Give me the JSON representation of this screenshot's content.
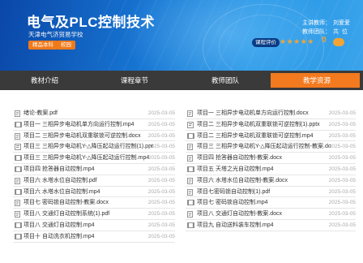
{
  "course": {
    "title": "电气及PLC控制技术",
    "school": "天津电气济贸易学校",
    "tags": [
      "精品本科",
      "校园"
    ]
  },
  "info": {
    "teacher_label": "主讲教师：",
    "teacher_name": "刘爱爱",
    "team_label": "教师团队：",
    "team_value_1": "共",
    "team_value_2": "位"
  },
  "rating": {
    "button_label": "课程评价",
    "stars": "★★★★★",
    "score": "0"
  },
  "tabs": [
    {
      "label": "教材介绍"
    },
    {
      "label": "课程章节"
    },
    {
      "label": "教师团队"
    },
    {
      "label": "教学资源"
    }
  ],
  "files_left": [
    {
      "name": "绪论-教案.pdf",
      "date": "2025-03-05",
      "type": "doc"
    },
    {
      "name": "项目一 三相异步电动机单方向运行控制.mp4",
      "date": "2025-03-05",
      "type": "video"
    },
    {
      "name": "项目二 三相异步电动机双重联锁可逆控制.docx",
      "date": "2025-03-05",
      "type": "doc"
    },
    {
      "name": "项目三 三相异步电动机Y-△降压起动运行控制(1).pptx",
      "date": "2025-03-05",
      "type": "ppt"
    },
    {
      "name": "项目三 三相异步电动机Y-△降压起动运行控制.mp4",
      "date": "2025-03-05",
      "type": "video"
    },
    {
      "name": "项目四 抢答器自动控制.mp4",
      "date": "2025-03-05",
      "type": "video"
    },
    {
      "name": "项目六 水塔水位自动控制.pdf",
      "date": "2025-03-05",
      "type": "doc"
    },
    {
      "name": "项目六 水塔水位自动控制.mp4",
      "date": "2025-03-05",
      "type": "video"
    },
    {
      "name": "项目七 密码锁自动控制-教案.docx",
      "date": "2025-03-05",
      "type": "doc"
    },
    {
      "name": "项目八 交通灯自动控制系统(1).pdf",
      "date": "2025-03-05",
      "type": "doc"
    },
    {
      "name": "项目八 交通灯自动控制.mp4",
      "date": "2025-03-05",
      "type": "video"
    },
    {
      "name": "项目十 自动洗衣机控制.mp4",
      "date": "2025-03-05",
      "type": "video"
    }
  ],
  "files_right": [
    {
      "name": "项目一 三相异步电动机单方向运行控制.docx",
      "date": "2025-03-05",
      "type": "doc"
    },
    {
      "name": "项目二 三相异步电动机双重联锁可逆控制(1).pptx",
      "date": "2025-03-05",
      "type": "ppt"
    },
    {
      "name": "项目二 三相异步电动机双重联锁可逆控制.mp4",
      "date": "2025-03-05",
      "type": "video"
    },
    {
      "name": "项目三 三相异步电动机Y-△降压起动运行控制-教案.do...",
      "date": "2025-03-05",
      "type": "doc"
    },
    {
      "name": "项目四 抢答器自动控制-教案.docx",
      "date": "2025-03-05",
      "type": "doc"
    },
    {
      "name": "项目五 天塔之光自动控制.mp4",
      "date": "2025-03-05",
      "type": "video"
    },
    {
      "name": "项目六 水塔水位自动控制-教案.docx",
      "date": "2025-03-05",
      "type": "doc"
    },
    {
      "name": "项目七密码锁自动控制(1).pdf",
      "date": "2025-03-05",
      "type": "doc"
    },
    {
      "name": "项目七 密码锁自动控制.mp4",
      "date": "2025-03-05",
      "type": "video"
    },
    {
      "name": "项目八 交通灯自动控制-教案.docx",
      "date": "2025-03-05",
      "type": "doc"
    },
    {
      "name": "项目九 自动送料装车控制.mp4",
      "date": "2025-03-05",
      "type": "video"
    }
  ],
  "colors": {
    "accent": "#f37a1e",
    "banner": "#1775d2",
    "tabbar": "#3a3a3a"
  },
  "icons": {
    "doc": "document-icon",
    "video": "video-icon",
    "ppt": "presentation-icon"
  }
}
